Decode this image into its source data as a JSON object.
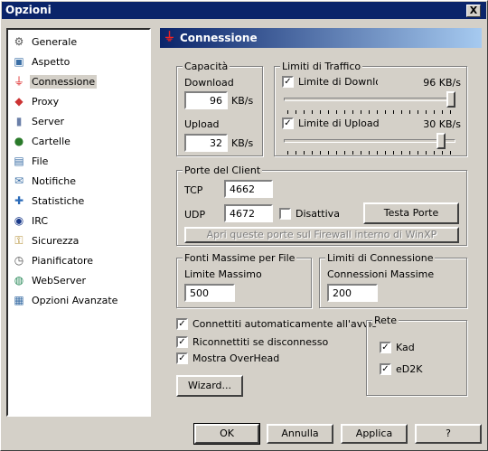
{
  "window": {
    "title": "Opzioni",
    "close_label": "X"
  },
  "sidebar": {
    "items": [
      {
        "label": "Generale",
        "icon": "gear-icon"
      },
      {
        "label": "Aspetto",
        "icon": "appearance-icon"
      },
      {
        "label": "Connessione",
        "icon": "connection-plug-icon",
        "selected": true
      },
      {
        "label": "Proxy",
        "icon": "proxy-icon"
      },
      {
        "label": "Server",
        "icon": "server-icon"
      },
      {
        "label": "Cartelle",
        "icon": "folder-icon"
      },
      {
        "label": "File",
        "icon": "file-icon"
      },
      {
        "label": "Notifiche",
        "icon": "notification-icon"
      },
      {
        "label": "Statistiche",
        "icon": "statistics-icon"
      },
      {
        "label": "IRC",
        "icon": "irc-icon"
      },
      {
        "label": "Sicurezza",
        "icon": "security-icon"
      },
      {
        "label": "Pianificatore",
        "icon": "scheduler-icon"
      },
      {
        "label": "WebServer",
        "icon": "globe-icon"
      },
      {
        "label": "Opzioni Avanzate",
        "icon": "advanced-options-icon"
      }
    ]
  },
  "panel": {
    "header": "Connessione",
    "capacity": {
      "title": "Capacità",
      "download_label": "Download",
      "download_value": "96",
      "upload_label": "Upload",
      "upload_value": "32",
      "unit": "KB/s"
    },
    "traffic": {
      "title": "Limiti di Traffico",
      "download_limit_label": "Limite di Downloac",
      "download_limit_value": "96 KB/s",
      "download_checked": true,
      "download_slider_level": 1.0,
      "upload_limit_label": "Limite di Upload",
      "upload_limit_value": "30 KB/s",
      "upload_checked": true,
      "upload_slider_level": 0.94
    },
    "ports": {
      "title": "Porte del Client",
      "tcp_label": "TCP",
      "tcp_value": "4662",
      "udp_label": "UDP",
      "udp_value": "4672",
      "disable_label": "Disattiva",
      "disable_checked": false,
      "test_button": "Testa Porte",
      "firewall_button": "Apri queste porte sul Firewall interno di WinXP"
    },
    "sources": {
      "title": "Fonti Massime per File",
      "max_label": "Limite Massimo",
      "max_value": "500"
    },
    "connections": {
      "title": "Limiti di Connessione",
      "max_label": "Connessioni Massime",
      "max_value": "200"
    },
    "options": [
      {
        "label": "Connettiti automaticamente all'avvio",
        "checked": true
      },
      {
        "label": "Riconnettiti se disconnesso",
        "checked": true
      },
      {
        "label": "Mostra OverHead",
        "checked": true
      }
    ],
    "network": {
      "title": "Rete",
      "kad_label": "Kad",
      "kad_checked": true,
      "ed2k_label": "eD2K",
      "ed2k_checked": true
    },
    "wizard_button": "Wizard..."
  },
  "footer": {
    "ok": "OK",
    "cancel": "Annulla",
    "apply": "Applica",
    "help": "?"
  },
  "check_mark": "✓"
}
